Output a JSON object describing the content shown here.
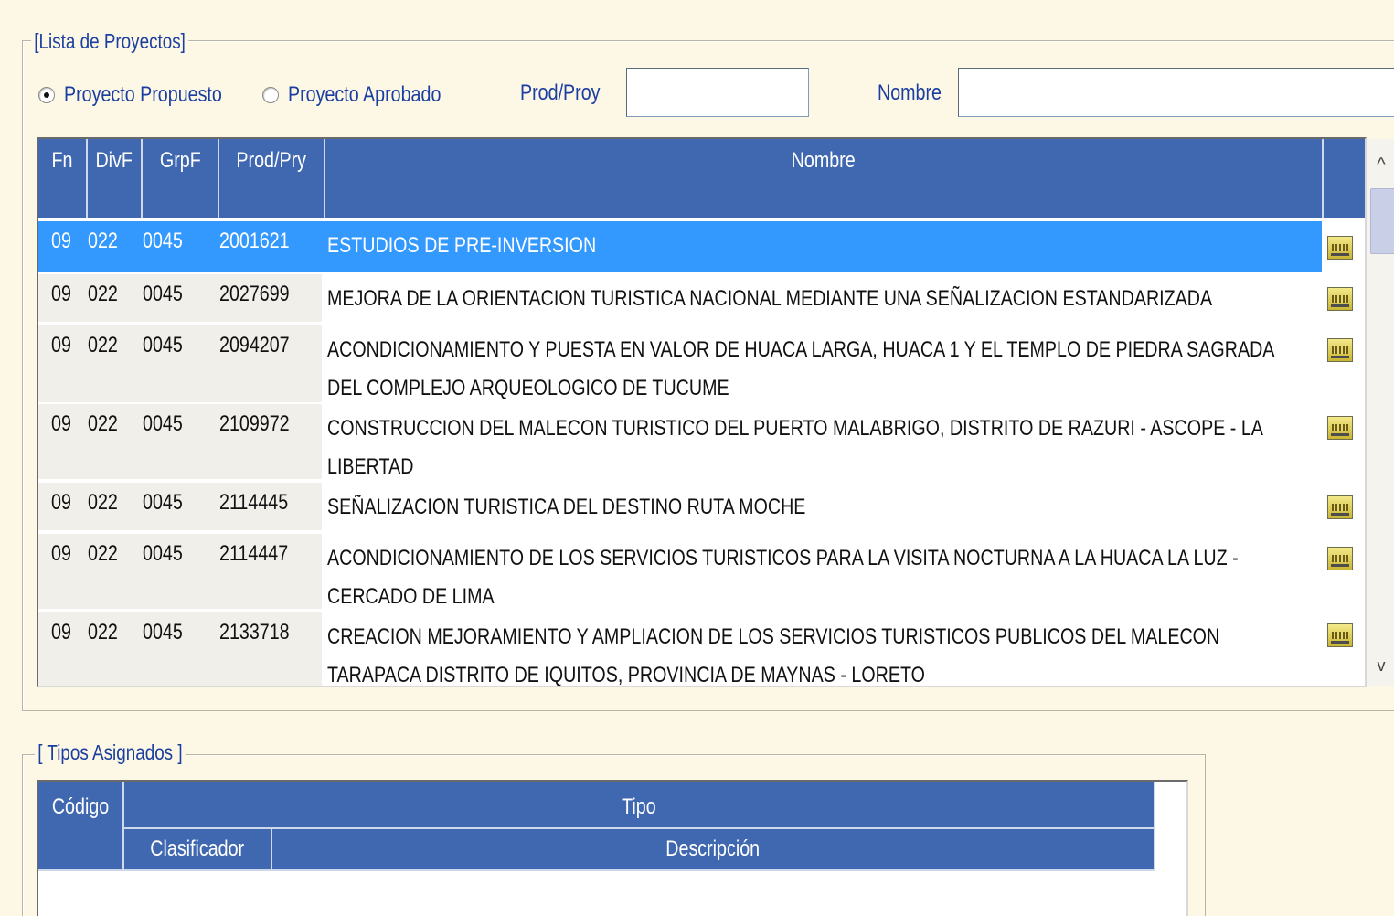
{
  "projects_panel": {
    "legend": "[Lista de Proyectos]",
    "radio_proposed": "Proyecto Propuesto",
    "radio_approved": "Proyecto Aprobado",
    "prod_label": "Prod/Proy",
    "prod_value": "",
    "name_label": "Nombre",
    "name_value": "",
    "columns": [
      "Fn",
      "DivF",
      "GrpF",
      "Prod/Pry",
      "Nombre"
    ],
    "rows": [
      {
        "fn": "09",
        "divf": "022",
        "grpf": "0045",
        "prod": "2001621",
        "nombre": "ESTUDIOS DE PRE-INVERSION",
        "selected": true
      },
      {
        "fn": "09",
        "divf": "022",
        "grpf": "0045",
        "prod": "2027699",
        "nombre": "MEJORA DE LA ORIENTACION TURISTICA NACIONAL MEDIANTE UNA SEÑALIZACION ESTANDARIZADA"
      },
      {
        "fn": "09",
        "divf": "022",
        "grpf": "0045",
        "prod": "2094207",
        "nombre": "ACONDICIONAMIENTO Y PUESTA EN VALOR DE HUACA LARGA, HUACA 1 Y EL TEMPLO DE PIEDRA SAGRADA DEL COMPLEJO ARQUEOLOGICO DE TUCUME"
      },
      {
        "fn": "09",
        "divf": "022",
        "grpf": "0045",
        "prod": "2109972",
        "nombre": "CONSTRUCCION DEL MALECON TURISTICO DEL PUERTO MALABRIGO, DISTRITO DE RAZURI - ASCOPE - LA LIBERTAD"
      },
      {
        "fn": "09",
        "divf": "022",
        "grpf": "0045",
        "prod": "2114445",
        "nombre": "SEÑALIZACION TURISTICA DEL DESTINO RUTA MOCHE"
      },
      {
        "fn": "09",
        "divf": "022",
        "grpf": "0045",
        "prod": "2114447",
        "nombre": "ACONDICIONAMIENTO DE LOS SERVICIOS TURISTICOS PARA LA VISITA NOCTURNA A LA HUACA LA LUZ - CERCADO DE LIMA"
      },
      {
        "fn": "09",
        "divf": "022",
        "grpf": "0045",
        "prod": "2133718",
        "nombre": "CREACION MEJORAMIENTO Y AMPLIACION DE LOS SERVICIOS TURISTICOS PUBLICOS DEL MALECON TARAPACA DISTRITO DE IQUITOS, PROVINCIA DE MAYNAS - LORETO"
      }
    ],
    "scroll_up": "^",
    "scroll_down": "v"
  },
  "types_panel": {
    "legend": "[ Tipos Asignados ]",
    "col_codigo": "Código",
    "col_tipo": "Tipo",
    "col_clasificador": "Clasificador",
    "col_descripcion": "Descripción"
  },
  "colors": {
    "background": "#fdf7e6",
    "header": "#4068b0",
    "selected_row": "#3399ff",
    "label_text": "#1a3fa0"
  }
}
